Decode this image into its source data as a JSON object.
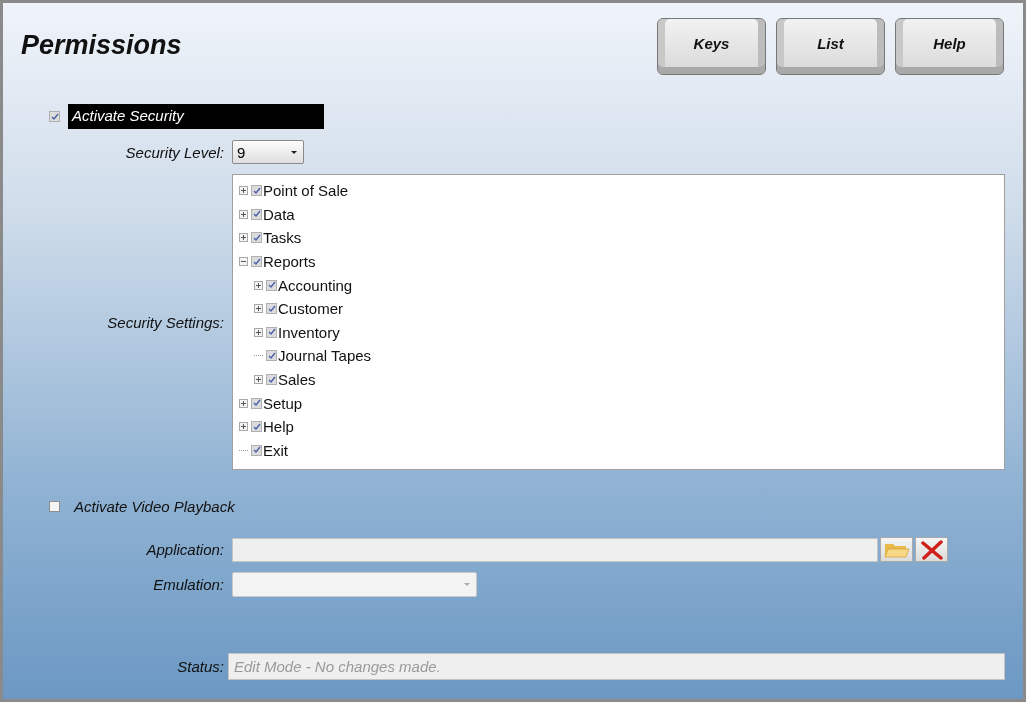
{
  "window": {
    "title": "Permissions"
  },
  "buttons": [
    "Keys",
    "List",
    "Help"
  ],
  "activate_security": {
    "label": "Activate Security",
    "checked": true,
    "disabled": true
  },
  "security_level": {
    "label": "Security Level:",
    "value": "9"
  },
  "security_settings": {
    "label": "Security Settings:",
    "tree": [
      {
        "label": "Point of Sale",
        "kind": "branch",
        "expanded": false,
        "checked": true
      },
      {
        "label": "Data",
        "kind": "branch",
        "expanded": false,
        "checked": true
      },
      {
        "label": "Tasks",
        "kind": "branch",
        "expanded": false,
        "checked": true
      },
      {
        "label": "Reports",
        "kind": "branch",
        "expanded": true,
        "checked": true,
        "children": [
          {
            "label": "Accounting",
            "kind": "branch",
            "expanded": false,
            "checked": true
          },
          {
            "label": "Customer",
            "kind": "branch",
            "expanded": false,
            "checked": true
          },
          {
            "label": "Inventory",
            "kind": "branch",
            "expanded": false,
            "checked": true
          },
          {
            "label": "Journal Tapes",
            "kind": "leaf",
            "checked": true
          },
          {
            "label": "Sales",
            "kind": "branch",
            "expanded": false,
            "checked": true
          }
        ]
      },
      {
        "label": "Setup",
        "kind": "branch",
        "expanded": false,
        "checked": true
      },
      {
        "label": "Help",
        "kind": "branch",
        "expanded": false,
        "checked": true
      },
      {
        "label": "Exit",
        "kind": "leaf",
        "checked": true
      }
    ]
  },
  "activate_video": {
    "label": "Activate Video Playback",
    "checked": false
  },
  "application": {
    "label": "Application:"
  },
  "emulation": {
    "label": "Emulation:"
  },
  "status": {
    "label": "Status:",
    "value": "Edit Mode - No changes made."
  }
}
